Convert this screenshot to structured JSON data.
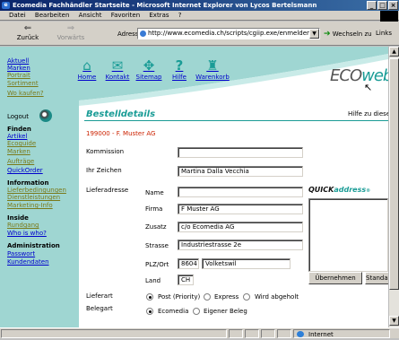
{
  "window": {
    "title": "Ecomedia Fachhändler Startseite - Microsoft Internet Explorer von Lycos Bertelsmann",
    "minimize": "_",
    "maximize": "□",
    "close": "×"
  },
  "menubar": {
    "items": [
      "Datei",
      "Bearbeiten",
      "Ansicht",
      "Favoriten",
      "Extras",
      "?"
    ]
  },
  "toolbar": {
    "back_label": "Zurück",
    "back_icon": "⇐",
    "forward_label": "Vorwärts",
    "forward_icon": "⇒",
    "address_label": "Adresse",
    "address_value": "http://www.ecomedia.ch/scripts/cgiip.exe/enmelden.w?r",
    "go_label": "Wechseln zu",
    "links_label": "Links"
  },
  "site": {
    "nav_top": [
      "Aktuell",
      "Marken",
      "Portrait",
      "Sortiment",
      "Wo kaufen?"
    ],
    "top_icons": [
      {
        "label": "Home",
        "icon": "⌂"
      },
      {
        "label": "Kontakt",
        "icon": "✉"
      },
      {
        "label": "Sitemap",
        "icon": "✥"
      },
      {
        "label": "Hilfe",
        "icon": "?"
      },
      {
        "label": "Warenkorb",
        "icon": "♜"
      }
    ],
    "logo_text_1": "ECO",
    "logo_text_2": "web",
    "logout": "Logout",
    "sections": [
      {
        "head": "Finden",
        "items": [
          "Artikel",
          "Ecoguide",
          "Marken",
          "Aufträge",
          "QuickOrder"
        ]
      },
      {
        "head": "Information",
        "items": [
          "Lieferbedingungen",
          "Dienstleistungen",
          "Marketing-Info"
        ]
      },
      {
        "head": "Inside",
        "items": [
          "Rundgang",
          "Who is who?"
        ]
      },
      {
        "head": "Administration",
        "items": [
          "Passwort",
          "Kundendaten"
        ]
      }
    ]
  },
  "form": {
    "title": "Bestelldetails",
    "help": "Hilfe zu dieser",
    "customer": "199000 - F. Muster AG",
    "kommission_label": "Kommission",
    "kommission_value": "",
    "ihr_zeichen_label": "Ihr Zeichen",
    "ihr_zeichen_value": "Martina Dalla Vecchia",
    "lieferadresse_label": "Lieferadresse",
    "name_label": "Name",
    "name_value": "",
    "firma_label": "Firma",
    "firma_value": "F Muster AG",
    "zusatz_label": "Zusatz",
    "zusatz_value": "c/o Ecomedia AG",
    "strasse_label": "Strasse",
    "strasse_value": "Industriestrasse 2e",
    "plzort_label": "PLZ/Ort",
    "plz_value": "8604",
    "ort_value": "Volketswil",
    "land_label": "Land",
    "land_value": "CH",
    "quickaddress_1": "QUICK",
    "quickaddress_2": "address",
    "uebernehmen": "Übernehmen",
    "standard": "Standard",
    "lieferart_label": "Lieferart",
    "lieferart_options": [
      "Post (Priority)",
      "Express",
      "Wird abgeholt"
    ],
    "lieferart_selected": "Post (Priority)",
    "belegart_label": "Belegart",
    "belegart_options": [
      "Ecomedia",
      "Eigener Beleg"
    ],
    "belegart_selected": "Ecomedia"
  },
  "status": {
    "zone": "Internet"
  },
  "colors": {
    "accent": "#1a9c96",
    "nav_bg": "#9fd6d2",
    "customer_red": "#cc2200",
    "titlebar": "#0a246a"
  }
}
